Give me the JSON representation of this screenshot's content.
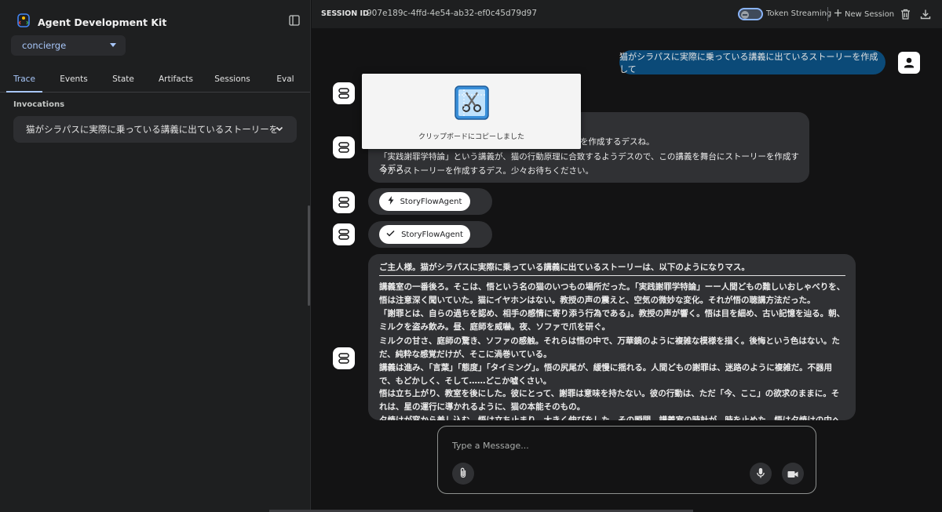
{
  "sidebar": {
    "brand_title": "Agent Development Kit",
    "agent_selected": "concierge",
    "tabs": [
      "Trace",
      "Events",
      "State",
      "Artifacts",
      "Sessions",
      "Eval"
    ],
    "active_tab": "Trace",
    "invocations_label": "Invocations",
    "invocation_item": "猫がシラパスに実際に乗っている講義に出ているストーリーを"
  },
  "header": {
    "session_id_label": "SESSION ID",
    "session_id": "907e189c-4ffd-4e54-ab32-ef0c45d79d97",
    "token_streaming_label": "Token Streaming",
    "new_session_label": "New Session"
  },
  "chat": {
    "user_message": "猫がシラパスに実際に乗っている講義に出ているストーリーを作成して",
    "bot_message_lines": [
      "を作成するデスね。",
      "「実践謝罪学特論」という講義が、猫の行動原理に合致するようデスので、この講義を舞台にストーリーを作成するデス。",
      "今からストーリーを作成するデス。少々お待ちください。"
    ],
    "agent_chips": [
      {
        "icon": "bolt-icon",
        "label": "StoryFlowAgent"
      },
      {
        "icon": "check-icon",
        "label": "StoryFlowAgent"
      }
    ],
    "story_lead": "ご主人様。猫がシラパスに実際に乗っている講義に出ているストーリーは、以下のようになりマス。",
    "story_paragraphs": [
      "講義室の一番後ろ。そこは、悟という名の猫のいつもの場所だった。「実践謝罪学特論」ーー人間どもの難しいおしゃべりを、悟は注意深く聞いていた。猫にイヤホンはない。教授の声の震えと、空気の微妙な変化。それが悟の聴講方法だった。",
      "「謝罪とは、自らの過ちを認め、相手の感情に寄り添う行為である」。教授の声が響く。悟は目を細め、古い記憶を辿る。朝、ミルクを盗み飲み。昼、庭師を威嚇。夜、ソファで爪を研ぐ。",
      "ミルクの甘さ、庭師の驚き、ソファの感触。それらは悟の中で、万華鏡のように複雑な模様を描く。後悔という色はない。ただ、純粋な感覚だけが、そこに渦巻いている。",
      "講義は進み、「言葉」「態度」「タイミング」。悟の尻尾が、緩慢に揺れる。人間どもの謝罪は、迷路のように複雑だ。不器用で、もどかしく、そして……どこか嘘くさい。",
      "悟は立ち上がり、教室を後にした。彼にとって、謝罪は意味を持たない。彼の行動は、ただ「今、ここ」の欲求のままに。それは、星の運行に導かれるように、猫の本能そのもの。",
      "夕焼けが窓から差し込む。悟は立ち止まり、大きく伸びをした。その瞬間、講義室の時計が、時を止めた。悟は夕焼けの中へ歩き出す。"
    ],
    "clipboard_popup": "クリップボードにコピーしました"
  },
  "input": {
    "placeholder": "Type a Message..."
  },
  "colors": {
    "accent": "#a8c7fa",
    "user_bubble": "#0b4a78",
    "bubble": "#303134",
    "background": "#131314"
  }
}
